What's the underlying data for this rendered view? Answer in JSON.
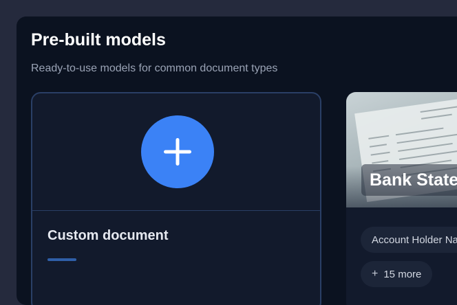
{
  "section": {
    "title": "Pre-built models",
    "subtitle": "Ready-to-use models for common document types"
  },
  "cards": {
    "custom": {
      "name": "Custom document",
      "icon": "plus-icon"
    },
    "bank": {
      "name": "Bank Statement",
      "fields": [
        "Account Holder Name"
      ],
      "more_label": "15 more",
      "more_icon": "plus-icon"
    }
  },
  "colors": {
    "accent": "#3b82f6",
    "panel_bg": "#0b1220",
    "page_bg": "#252a3d"
  }
}
